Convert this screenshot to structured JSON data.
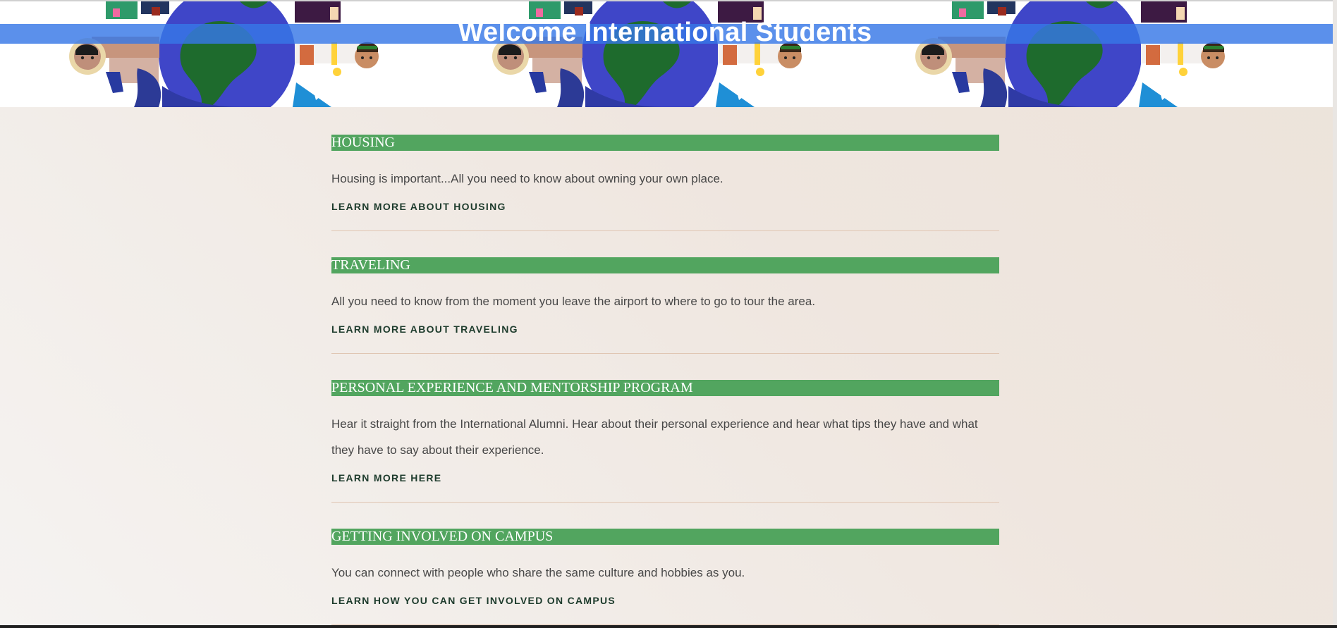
{
  "header": {
    "title": "Welcome International Students",
    "banner_art": "children-around-globe-illustration"
  },
  "sections": [
    {
      "heading": "HOUSING",
      "text": "Housing is important...All you need to know about owning your own place.",
      "link": "LEARN MORE ABOUT HOUSING"
    },
    {
      "heading": "TRAVELING",
      "text": "All you need to know from the moment you leave the airport to where to go to tour the area.",
      "link": "LEARN MORE ABOUT TRAVELING"
    },
    {
      "heading": "PERSONAL EXPERIENCE AND MENTORSHIP PROGRAM",
      "text": "Hear it straight from the International Alumni. Hear about their personal experience and hear what tips they have and what they have to say about their experience.",
      "link": "LEARN MORE HERE"
    },
    {
      "heading": "GETTING INVOLVED ON CAMPUS",
      "text": "You can connect with people who share the same culture and hobbies as you.",
      "link": "LEARN HOW YOU CAN GET INVOLVED ON CAMPUS"
    }
  ],
  "colors": {
    "heading_bar": "#52a55f",
    "title_bar": "#3778e6",
    "link_text": "#1d3b2c"
  }
}
